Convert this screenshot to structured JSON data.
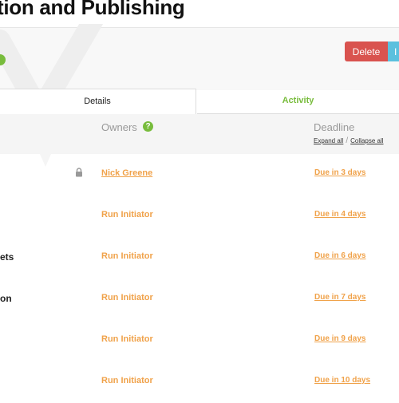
{
  "header": {
    "title": "tion and Publishing"
  },
  "actions": {
    "delete_label": "Delete",
    "second_label": "I"
  },
  "tabs": [
    {
      "label": "Details",
      "active": true
    },
    {
      "label": "Activity",
      "active": false
    }
  ],
  "table": {
    "owners_header": "Owners",
    "owners_help": "?",
    "deadline_header": "Deadline",
    "expand_all": "Expand all",
    "separator": "/",
    "collapse_all": "Collapse all",
    "rows": [
      {
        "name": "",
        "owner": "Nick Greene",
        "due": "Due in 3 days",
        "locked": true
      },
      {
        "name": "",
        "owner": "Run Initiator",
        "due": "Due in 4 days"
      },
      {
        "name": "ets",
        "owner": "Run Initiator",
        "due": "Due in 6 days"
      },
      {
        "name": "on",
        "owner": "Run Initiator",
        "due": "Due in 7 days"
      },
      {
        "name": "",
        "owner": "Run Initiator",
        "due": "Due in 9 days"
      },
      {
        "name": "",
        "owner": "Run Initiator",
        "due": "Due in 10 days"
      }
    ]
  },
  "colors": {
    "accent_green": "#78bc3c",
    "owner_orange": "#f0a24a",
    "delete_red": "#d9534f",
    "info_blue": "#5bc0de"
  }
}
